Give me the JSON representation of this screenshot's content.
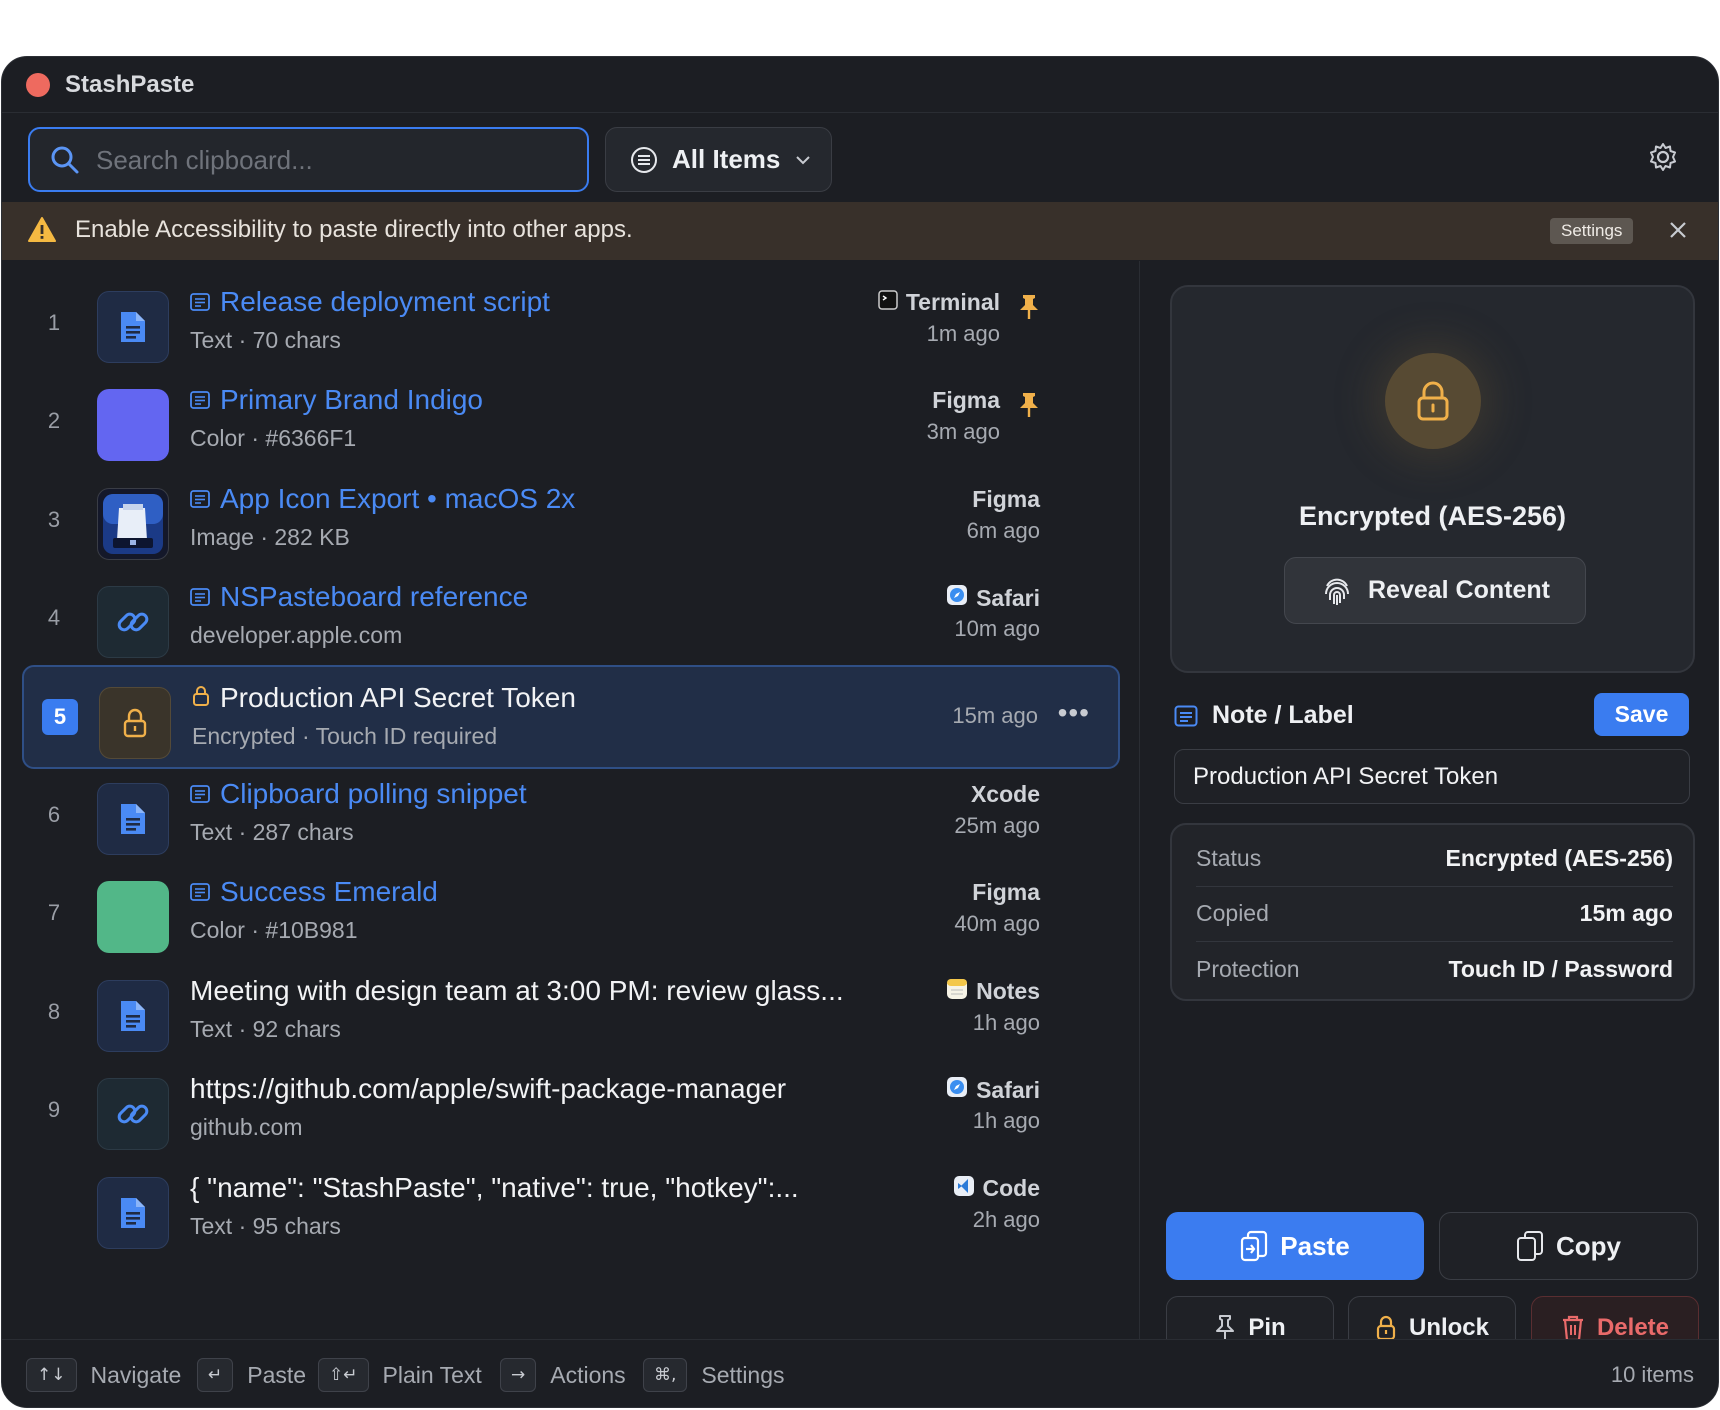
{
  "app": {
    "title": "StashPaste"
  },
  "toolbar": {
    "search_placeholder": "Search clipboard...",
    "search_value": "",
    "filter_label": "All Items"
  },
  "banner": {
    "message": "Enable Accessibility to paste directly into other apps.",
    "settings_label": "Settings"
  },
  "items": [
    {
      "index": "1",
      "title": "Release deployment script",
      "subtitle": "Text · 70 chars",
      "source": "Terminal",
      "time": "1m ago",
      "pinned": true,
      "kind": "text",
      "labeled": true
    },
    {
      "index": "2",
      "title": "Primary Brand Indigo",
      "subtitle": "Color · #6366F1",
      "source": "Figma",
      "time": "3m ago",
      "pinned": true,
      "kind": "color",
      "color": "#6366F1",
      "labeled": true
    },
    {
      "index": "3",
      "title": "App Icon Export • macOS 2x",
      "subtitle": "Image · 282 KB",
      "source": "Figma",
      "time": "6m ago",
      "pinned": false,
      "kind": "image",
      "labeled": true
    },
    {
      "index": "4",
      "title": "NSPasteboard reference",
      "subtitle": "developer.apple.com",
      "source": "Safari",
      "time": "10m ago",
      "pinned": false,
      "kind": "link",
      "labeled": true
    },
    {
      "index": "5",
      "title": "Production API Secret Token",
      "subtitle": "Encrypted · Touch ID required",
      "source": "",
      "time": "15m ago",
      "pinned": false,
      "kind": "encrypted",
      "selected": true
    },
    {
      "index": "6",
      "title": "Clipboard polling snippet",
      "subtitle": "Text · 287 chars",
      "source": "Xcode",
      "time": "25m ago",
      "pinned": false,
      "kind": "text",
      "labeled": true
    },
    {
      "index": "7",
      "title": "Success Emerald",
      "subtitle": "Color · #10B981",
      "source": "Figma",
      "time": "40m ago",
      "pinned": false,
      "kind": "color",
      "color": "#52b788",
      "labeled": true
    },
    {
      "index": "8",
      "title": "Meeting with design team at 3:00 PM: review glass...",
      "subtitle": "Text · 92 chars",
      "source": "Notes",
      "time": "1h ago",
      "pinned": false,
      "kind": "text",
      "labeled": false
    },
    {
      "index": "9",
      "title": "https://github.com/apple/swift-package-manager",
      "subtitle": "github.com",
      "source": "Safari",
      "time": "1h ago",
      "pinned": false,
      "kind": "link",
      "labeled": false
    },
    {
      "index": "",
      "title": "{   \"name\": \"StashPaste\",   \"native\": true,   \"hotkey\":...",
      "subtitle": "Text · 95 chars",
      "source": "Code",
      "time": "2h ago",
      "pinned": false,
      "kind": "text",
      "labeled": false
    }
  ],
  "detail": {
    "encryption_label": "Encrypted (AES-256)",
    "reveal_label": "Reveal Content",
    "note_heading": "Note / Label",
    "save_label": "Save",
    "note_value": "Production API Secret Token",
    "meta": [
      {
        "key": "Status",
        "value": "Encrypted (AES-256)"
      },
      {
        "key": "Copied",
        "value": "15m ago"
      },
      {
        "key": "Protection",
        "value": "Touch ID / Password"
      }
    ],
    "actions": {
      "paste": "Paste",
      "copy": "Copy",
      "pin": "Pin",
      "unlock": "Unlock",
      "delete": "Delete"
    }
  },
  "footer": {
    "hints": [
      {
        "keys": "↑↓",
        "label": "Navigate"
      },
      {
        "keys": "↵",
        "label": "Paste"
      },
      {
        "keys": "⇧↵",
        "label": "Plain Text"
      },
      {
        "keys": "→",
        "label": "Actions"
      },
      {
        "keys": "⌘,",
        "label": "Settings"
      }
    ],
    "count": "10 items"
  },
  "colors": {
    "accent": "#3A7CF0",
    "warning": "#F5B942",
    "danger": "#E96A6A",
    "background": "#1C1E23"
  }
}
